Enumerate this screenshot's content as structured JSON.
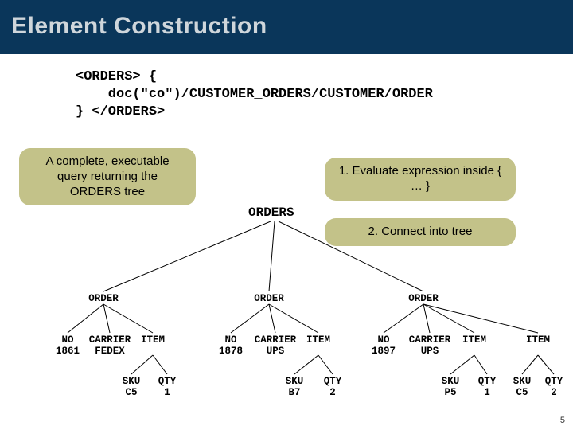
{
  "title": "Element Construction",
  "code": {
    "line1": "<ORDERS> {",
    "line2": "    doc(\"co\")/CUSTOMER_ORDERS/CUSTOMER/ORDER",
    "line3": "} </ORDERS>"
  },
  "callouts": {
    "left": "A complete, executable query returning the ORDERS tree",
    "step1": "1. Evaluate expression inside { … }",
    "step2": "2. Connect into tree"
  },
  "tree": {
    "root": "ORDERS",
    "orders": [
      {
        "label": "ORDER",
        "no": {
          "label": "NO",
          "value": "1861"
        },
        "carrier": {
          "label": "CARRIER",
          "value": "FEDEX"
        },
        "items": [
          {
            "label": "ITEM",
            "sku": {
              "label": "SKU",
              "value": "C5"
            },
            "qty": {
              "label": "QTY",
              "value": "1"
            }
          }
        ]
      },
      {
        "label": "ORDER",
        "no": {
          "label": "NO",
          "value": "1878"
        },
        "carrier": {
          "label": "CARRIER",
          "value": "UPS"
        },
        "items": [
          {
            "label": "ITEM",
            "sku": {
              "label": "SKU",
              "value": "B7"
            },
            "qty": {
              "label": "QTY",
              "value": "2"
            }
          }
        ]
      },
      {
        "label": "ORDER",
        "no": {
          "label": "NO",
          "value": "1897"
        },
        "carrier": {
          "label": "CARRIER",
          "value": "UPS"
        },
        "items": [
          {
            "label": "ITEM",
            "sku": {
              "label": "SKU",
              "value": "P5"
            },
            "qty": {
              "label": "QTY",
              "value": "1"
            }
          },
          {
            "label": "ITEM",
            "sku": {
              "label": "SKU",
              "value": "C5"
            },
            "qty": {
              "label": "QTY",
              "value": "2"
            }
          }
        ]
      }
    ]
  },
  "page_number": "5"
}
